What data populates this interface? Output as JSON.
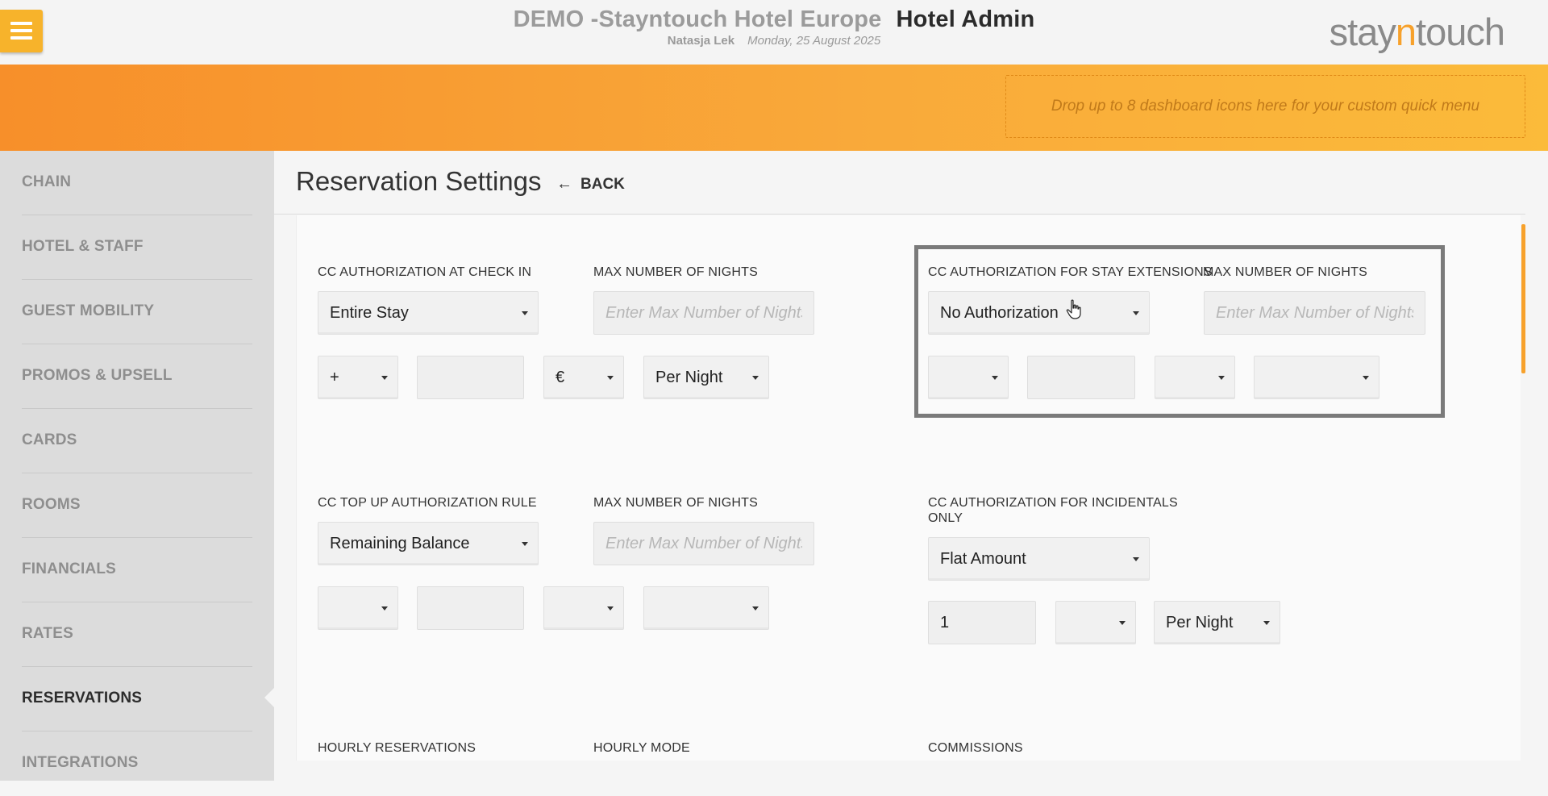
{
  "header": {
    "hotel_name": "DEMO -Stayntouch Hotel Europe",
    "section": "Hotel Admin",
    "user": "Natasja Lek",
    "date": "Monday, 25 August 2025",
    "logo_prefix": "stay",
    "logo_accent": "n",
    "logo_suffix": "touch"
  },
  "quick_menu": {
    "placeholder": "Drop up to 8 dashboard icons here for your custom quick menu"
  },
  "sidebar": {
    "items": [
      {
        "label": "CHAIN"
      },
      {
        "label": "HOTEL & STAFF"
      },
      {
        "label": "GUEST MOBILITY"
      },
      {
        "label": "PROMOS & UPSELL"
      },
      {
        "label": "CARDS"
      },
      {
        "label": "ROOMS"
      },
      {
        "label": "FINANCIALS"
      },
      {
        "label": "RATES"
      },
      {
        "label": "RESERVATIONS",
        "active": true
      },
      {
        "label": "INTEGRATIONS"
      }
    ]
  },
  "page": {
    "title": "Reservation Settings",
    "back_label": "BACK"
  },
  "form": {
    "cc_checkin": {
      "label": "CC AUTHORIZATION AT CHECK IN",
      "value": "Entire Stay",
      "max_nights_label": "MAX NUMBER OF NIGHTS",
      "max_nights_placeholder": "Enter Max Number of Nights",
      "operator": "+",
      "amount": "",
      "currency": "€",
      "period": "Per Night"
    },
    "cc_extensions": {
      "label": "CC AUTHORIZATION FOR STAY EXTENSIONS",
      "value": "No Authorization",
      "max_nights_label": "MAX NUMBER OF NIGHTS",
      "max_nights_placeholder": "Enter Max Number of Nights",
      "operator": "",
      "amount": "",
      "currency": "",
      "period": ""
    },
    "cc_topup": {
      "label": "CC TOP UP AUTHORIZATION RULE",
      "value": "Remaining Balance",
      "max_nights_label": "MAX NUMBER OF NIGHTS",
      "max_nights_placeholder": "Enter Max Number of Nights",
      "operator": "",
      "amount": "",
      "currency": "",
      "period": ""
    },
    "cc_incidentals": {
      "label_line1": "CC AUTHORIZATION FOR INCIDENTALS",
      "label_line2": "ONLY",
      "value": "Flat Amount",
      "amount": "1",
      "currency": "",
      "period": "Per Night"
    },
    "hourly_reservations_label": "HOURLY RESERVATIONS",
    "hourly_mode_label": "HOURLY MODE",
    "commissions_label": "COMMISSIONS"
  },
  "colors": {
    "accent": "#f7a12b",
    "menu_button": "#f7b32b",
    "highlight_border": "#7a7a7a"
  },
  "icons": {
    "menu": "hamburger-icon",
    "back": "arrow-left-icon",
    "dropdown": "caret-down-icon",
    "cursor": "hand-pointer-icon"
  }
}
